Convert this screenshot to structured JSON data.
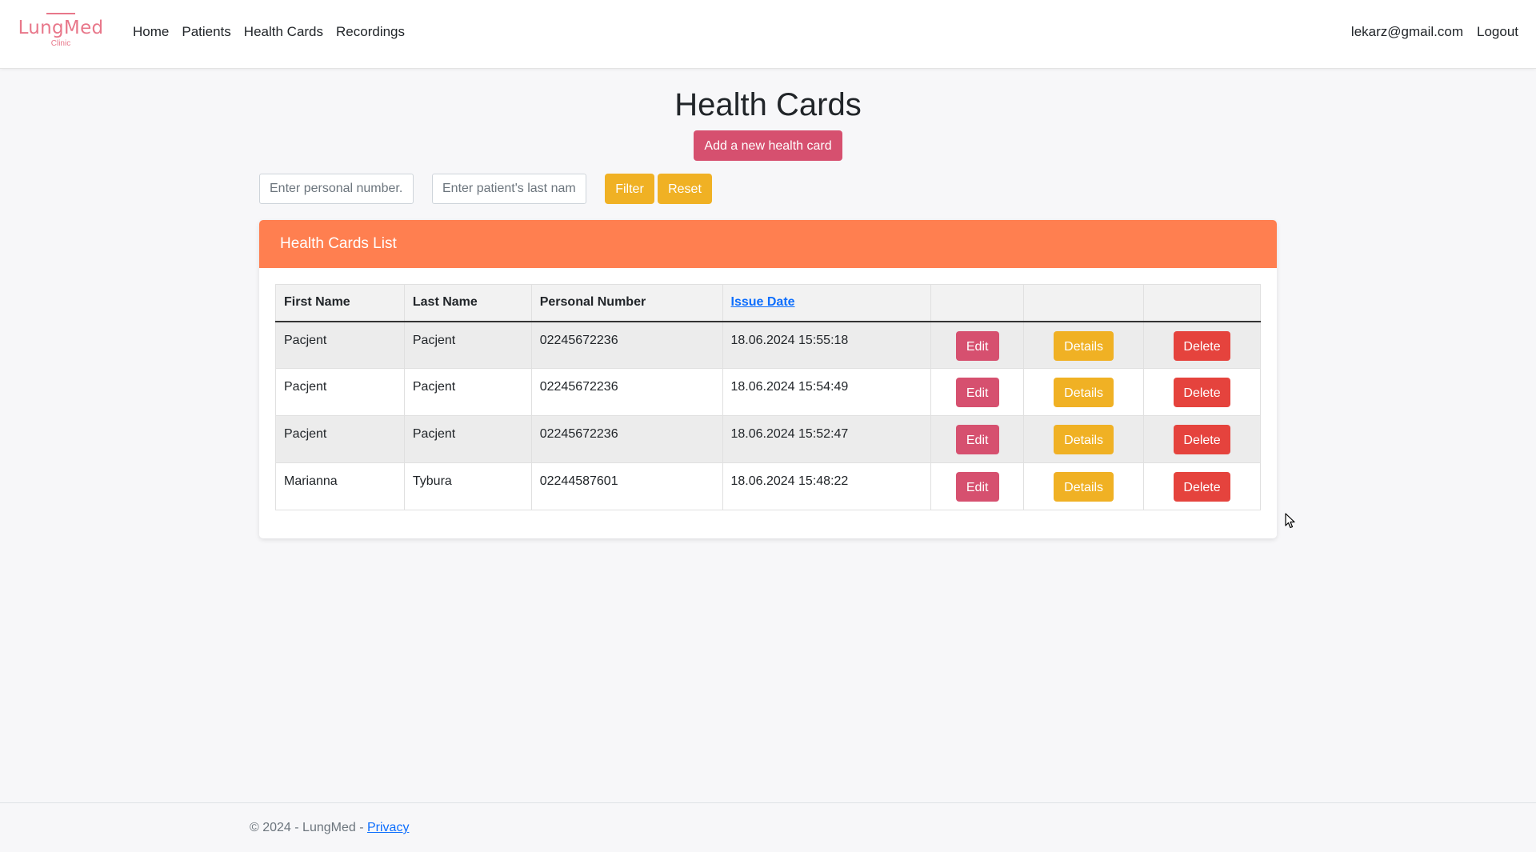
{
  "brand": {
    "name": "LungMed",
    "sub": "Clinic",
    "color": "#e8778a"
  },
  "nav": {
    "links": [
      "Home",
      "Patients",
      "Health Cards",
      "Recordings"
    ],
    "user_email": "lekarz@gmail.com",
    "logout": "Logout"
  },
  "page": {
    "title": "Health Cards",
    "add_button": "Add a new health card"
  },
  "filter": {
    "personal_number_placeholder": "Enter personal number...",
    "last_name_placeholder": "Enter patient's last name...",
    "filter_button": "Filter",
    "reset_button": "Reset"
  },
  "card": {
    "header": "Health Cards List",
    "header_color": "#ff7f50"
  },
  "table": {
    "columns": [
      "First Name",
      "Last Name",
      "Personal Number",
      "Issue Date"
    ],
    "action_labels": {
      "edit": "Edit",
      "details": "Details",
      "delete": "Delete"
    },
    "rows": [
      {
        "first": "Pacjent",
        "last": "Pacjent",
        "personal": "02245672236",
        "date": "18.06.2024 15:55:18"
      },
      {
        "first": "Pacjent",
        "last": "Pacjent",
        "personal": "02245672236",
        "date": "18.06.2024 15:54:49"
      },
      {
        "first": "Pacjent",
        "last": "Pacjent",
        "personal": "02245672236",
        "date": "18.06.2024 15:52:47"
      },
      {
        "first": "Marianna",
        "last": "Tybura",
        "personal": "02244587601",
        "date": "18.06.2024 15:48:22"
      }
    ]
  },
  "footer": {
    "text": "© 2024 - LungMed - ",
    "privacy": "Privacy"
  },
  "colors": {
    "edit": "#d6506f",
    "details": "#f0b124",
    "delete": "#e5433d"
  }
}
